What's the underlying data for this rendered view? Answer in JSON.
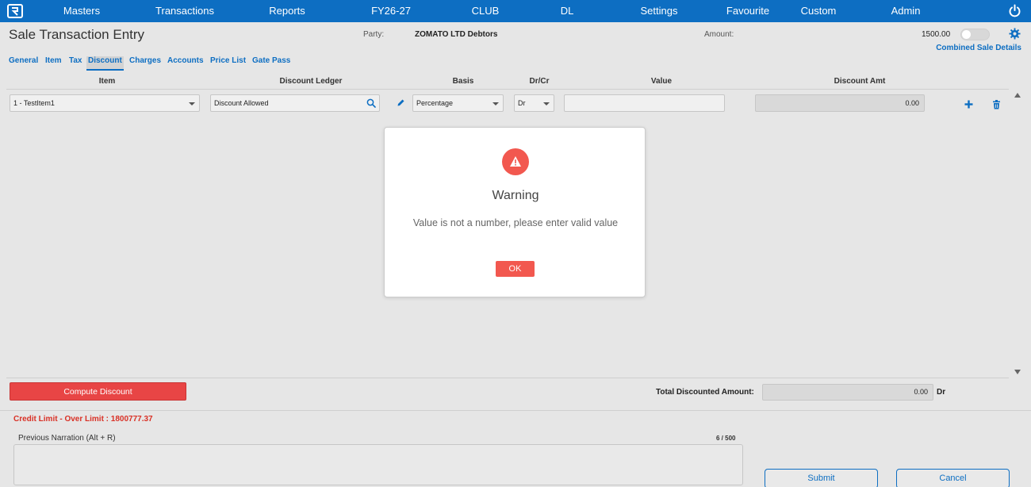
{
  "nav": {
    "items": [
      "Masters",
      "Transactions",
      "Reports",
      "FY26-27",
      "CLUB",
      "DL",
      "Settings",
      "Favourite",
      "Custom",
      "Admin"
    ]
  },
  "header": {
    "title": "Sale Transaction Entry",
    "party_label": "Party:",
    "party_value": "ZOMATO LTD Debtors",
    "amount_label": "Amount:",
    "amount_value": "1500.00",
    "combined_link": "Combined Sale Details"
  },
  "tabs": [
    {
      "label": "General"
    },
    {
      "label": "Item"
    },
    {
      "label": "Tax"
    },
    {
      "label": "Discount",
      "active": true
    },
    {
      "label": "Charges"
    },
    {
      "label": "Accounts"
    },
    {
      "label": "Price List"
    },
    {
      "label": "Gate Pass"
    }
  ],
  "grid": {
    "columns": [
      "Item",
      "Discount Ledger",
      "Basis",
      "Dr/Cr",
      "Value",
      "Discount Amt"
    ],
    "row": {
      "item": "1 - TestItem1",
      "ledger": "Discount Allowed",
      "basis": "Percentage",
      "drcr": "Dr",
      "value": "",
      "discount_amt": "0.00"
    }
  },
  "modal": {
    "title": "Warning",
    "message": "Value is not a number, please enter valid value",
    "ok_label": "OK"
  },
  "footer": {
    "compute_label": "Compute Discount",
    "total_label": "Total Discounted Amount:",
    "total_value": "0.00",
    "total_suffix": "Dr",
    "credit_limit": "Credit Limit - Over Limit : 1800777.37",
    "narration_label": "Previous Narration (Alt + R)",
    "narration_count": "6 / 500",
    "narration_value": "",
    "submit_label": "Submit",
    "cancel_label": "Cancel"
  },
  "colors": {
    "nav_bg": "#0d6ec2",
    "accent": "#0d6ec2",
    "danger": "#e84545",
    "warning_icon": "#f2584f"
  },
  "icons": [
    "logo-icon",
    "power-icon",
    "gear-icon",
    "search-icon",
    "edit-pencil-icon",
    "add-icon",
    "delete-icon",
    "warning-icon"
  ]
}
